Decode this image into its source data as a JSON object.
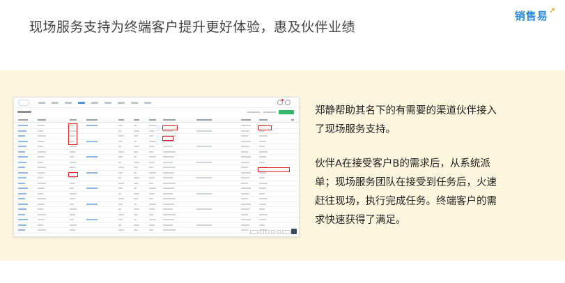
{
  "slide": {
    "title": "现场服务支持为终端客户提升更好体验，惠及伙伴业绩",
    "brand": {
      "name": "销售易",
      "accent_color": "#2d8ad8",
      "arrow_color": "#f3a21a"
    },
    "band_color": "#fdf6df"
  },
  "screenshot": {
    "icons": [
      "bell-icon",
      "help-icon"
    ],
    "primary_button_color": "#2fb86b",
    "highlight_color": "#e02020",
    "row_count": 21
  },
  "description": {
    "paragraph1": [
      "郑静帮助其名下的有需要的渠道伙伴接入",
      "了现场服务支持。"
    ],
    "paragraph2": [
      "伙伴A在接受客户B的需求后，从系统派",
      "单；现场服务团队在接受到任务后，火速",
      "赶往现场，执行完成任务。终端客户的需",
      "求快速获得了满足。"
    ]
  }
}
